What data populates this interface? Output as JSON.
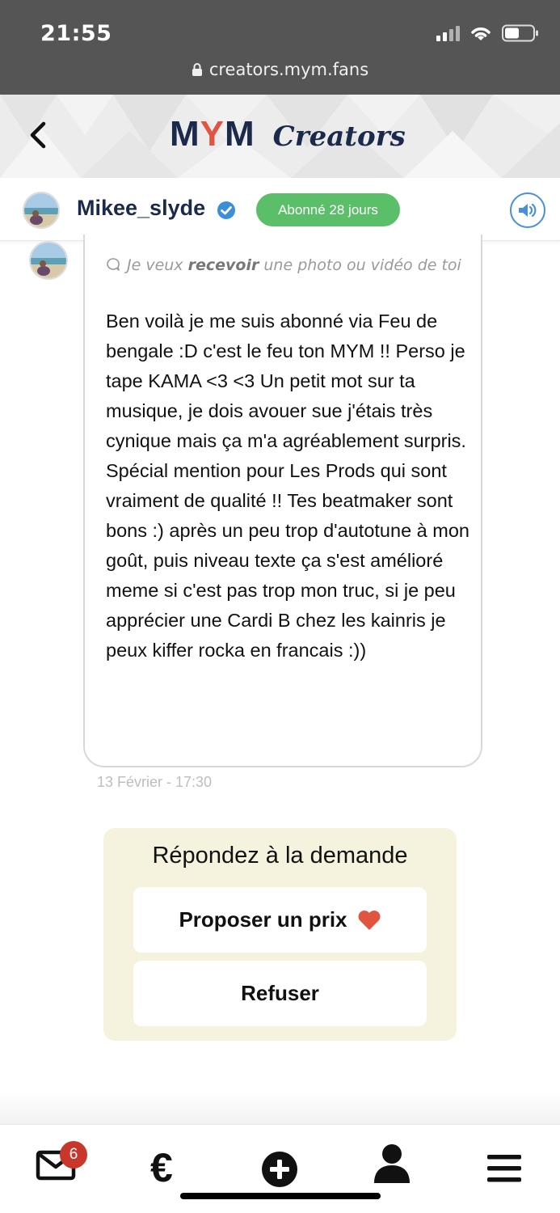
{
  "status_bar": {
    "time": "21:55",
    "url": "creators.mym.fans"
  },
  "header": {
    "brand_mym_m1": "M",
    "brand_mym_y": "Y",
    "brand_mym_m2": "M",
    "brand_creators": "Creators"
  },
  "user": {
    "username": "Mikee_slyde",
    "subscription_badge": "Abonné 28 jours"
  },
  "message": {
    "request_prefix": "Je veux",
    "request_bold": "recevoir",
    "request_suffix": "une photo ou vidéo de toi",
    "text": "Ben voilà je me suis abonné via Feu de bengale :D c'est le feu ton MYM !! Perso je tape KAMA <3 <3 Un petit mot sur ta musique, je dois avouer sue j'étais très cynique mais ça m'a agréablement surpris. Spécial mention pour Les Prods qui sont vraiment de qualité !! Tes beatmaker sont bons :) après un peu trop d'autotune à mon goût, puis niveau texte ça s'est amélioré meme si c'est pas trop mon truc, si je peu apprécier une Cardi B chez les kainris je peux kiffer rocka en francais :))",
    "timestamp": "13 Février - 17:30"
  },
  "respond": {
    "title": "Répondez à la demande",
    "propose_label": "Proposer un prix",
    "refuse_label": "Refuser"
  },
  "bottom_nav": {
    "mail_count": "6",
    "euro_symbol": "€"
  },
  "colors": {
    "brand_navy": "#1b2a4a",
    "brand_red": "#e05540",
    "badge_green": "#5bbf69",
    "respond_bg": "#f5f3de",
    "heart_red": "#e05540",
    "notification_red": "#c9372c"
  }
}
